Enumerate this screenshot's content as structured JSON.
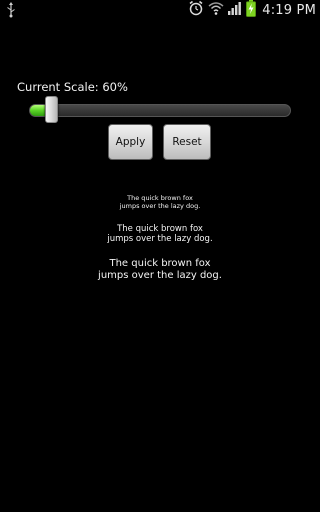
{
  "status_bar": {
    "time": "4:19 PM",
    "icons": [
      "usb-icon",
      "alarm-icon",
      "wifi-icon",
      "signal-icon",
      "battery-charging-icon"
    ],
    "battery_color": "#7ed321"
  },
  "scale": {
    "label": "Current Scale: 60%",
    "value_fraction": 0.06
  },
  "buttons": {
    "apply_label": "Apply",
    "reset_label": "Reset"
  },
  "samples": {
    "small": "The quick brown fox\njumps over the lazy dog.",
    "medium": "The quick brown fox\njumps over the lazy dog.",
    "large": "The quick brown fox\njumps over the lazy dog."
  },
  "colors": {
    "background": "#000000",
    "seek_fill": "#5fd82a"
  }
}
